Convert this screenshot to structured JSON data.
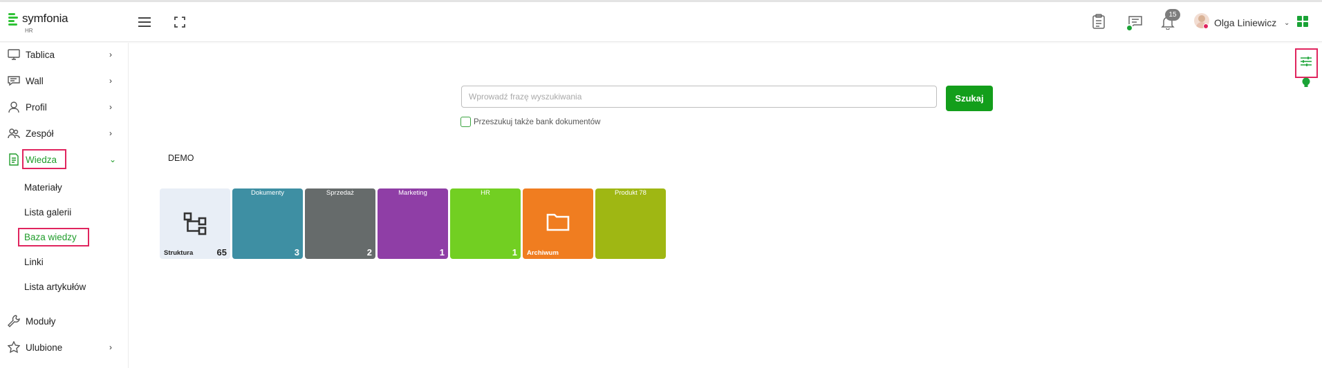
{
  "app": {
    "logo_text": "symfonia",
    "logo_sub": "HR"
  },
  "header": {
    "menu_icon": "hamburger-icon",
    "fullscreen_icon": "fullscreen-icon",
    "notification_count": "15",
    "user_name": "Olga Liniewicz"
  },
  "sidebar": {
    "items": [
      {
        "label": "Tablica",
        "icon": "monitor-icon"
      },
      {
        "label": "Wall",
        "icon": "chat-icon"
      },
      {
        "label": "Profil",
        "icon": "user-icon"
      },
      {
        "label": "Zespół",
        "icon": "team-icon"
      },
      {
        "label": "Wiedza",
        "icon": "document-icon"
      },
      {
        "label": "Moduły",
        "icon": "wrench-icon"
      },
      {
        "label": "Ulubione",
        "icon": "star-icon"
      }
    ],
    "sub_items": [
      {
        "label": "Materiały"
      },
      {
        "label": "Lista galerii"
      },
      {
        "label": "Baza wiedzy"
      },
      {
        "label": "Linki"
      },
      {
        "label": "Lista artykułów"
      }
    ]
  },
  "search": {
    "placeholder": "Wprowadź frazę wyszukiwania",
    "value": "",
    "button_label": "Szukaj",
    "checkbox_label": "Przeszukuj także bank dokumentów"
  },
  "section": {
    "title": "DEMO"
  },
  "tiles": [
    {
      "title": "",
      "bottom": "Struktura",
      "count": "65",
      "color": "#e8eef6"
    },
    {
      "title": "Dokumenty",
      "bottom": "",
      "count": "3",
      "color": "#3e8fa3"
    },
    {
      "title": "Sprzedaż",
      "bottom": "",
      "count": "2",
      "color": "#666b6b"
    },
    {
      "title": "Marketing",
      "bottom": "",
      "count": "1",
      "color": "#8f3ea6"
    },
    {
      "title": "HR",
      "bottom": "",
      "count": "1",
      "color": "#72cf22"
    },
    {
      "title": "",
      "bottom": "Archiwum",
      "count": "",
      "color": "#f07d20"
    },
    {
      "title": "Produkt 78",
      "bottom": "",
      "count": "",
      "color": "#9fb713"
    }
  ]
}
